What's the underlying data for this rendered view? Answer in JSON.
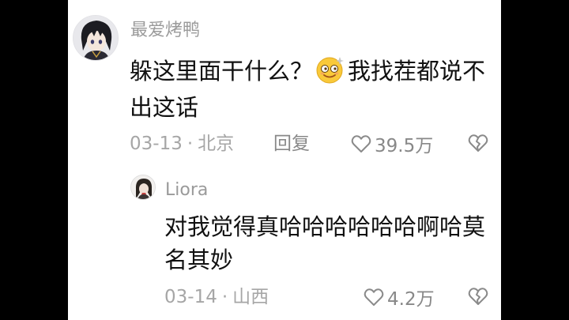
{
  "comment": {
    "username": "最爱烤鸭",
    "text_before_emoji": "躲这里面干什么？",
    "emoji_icon": "dizzy-face-emoji",
    "text_after_emoji": "我找茬都说不出这话",
    "date": "03-13",
    "separator": "·",
    "location": "北京",
    "reply_label": "回复",
    "like_count": "39.5万"
  },
  "reply": {
    "username": "Liora",
    "text": "对我觉得真哈哈哈哈哈哈啊哈莫名其妙",
    "date": "03-14",
    "separator": "·",
    "location": "山西",
    "like_count": "4.2万"
  },
  "colors": {
    "text_primary": "#111111",
    "text_secondary": "#9a9a9a",
    "background": "#ffffff",
    "letterbox": "#000000"
  },
  "icons": [
    "heart-outline-icon",
    "broken-heart-icon",
    "avatar"
  ]
}
